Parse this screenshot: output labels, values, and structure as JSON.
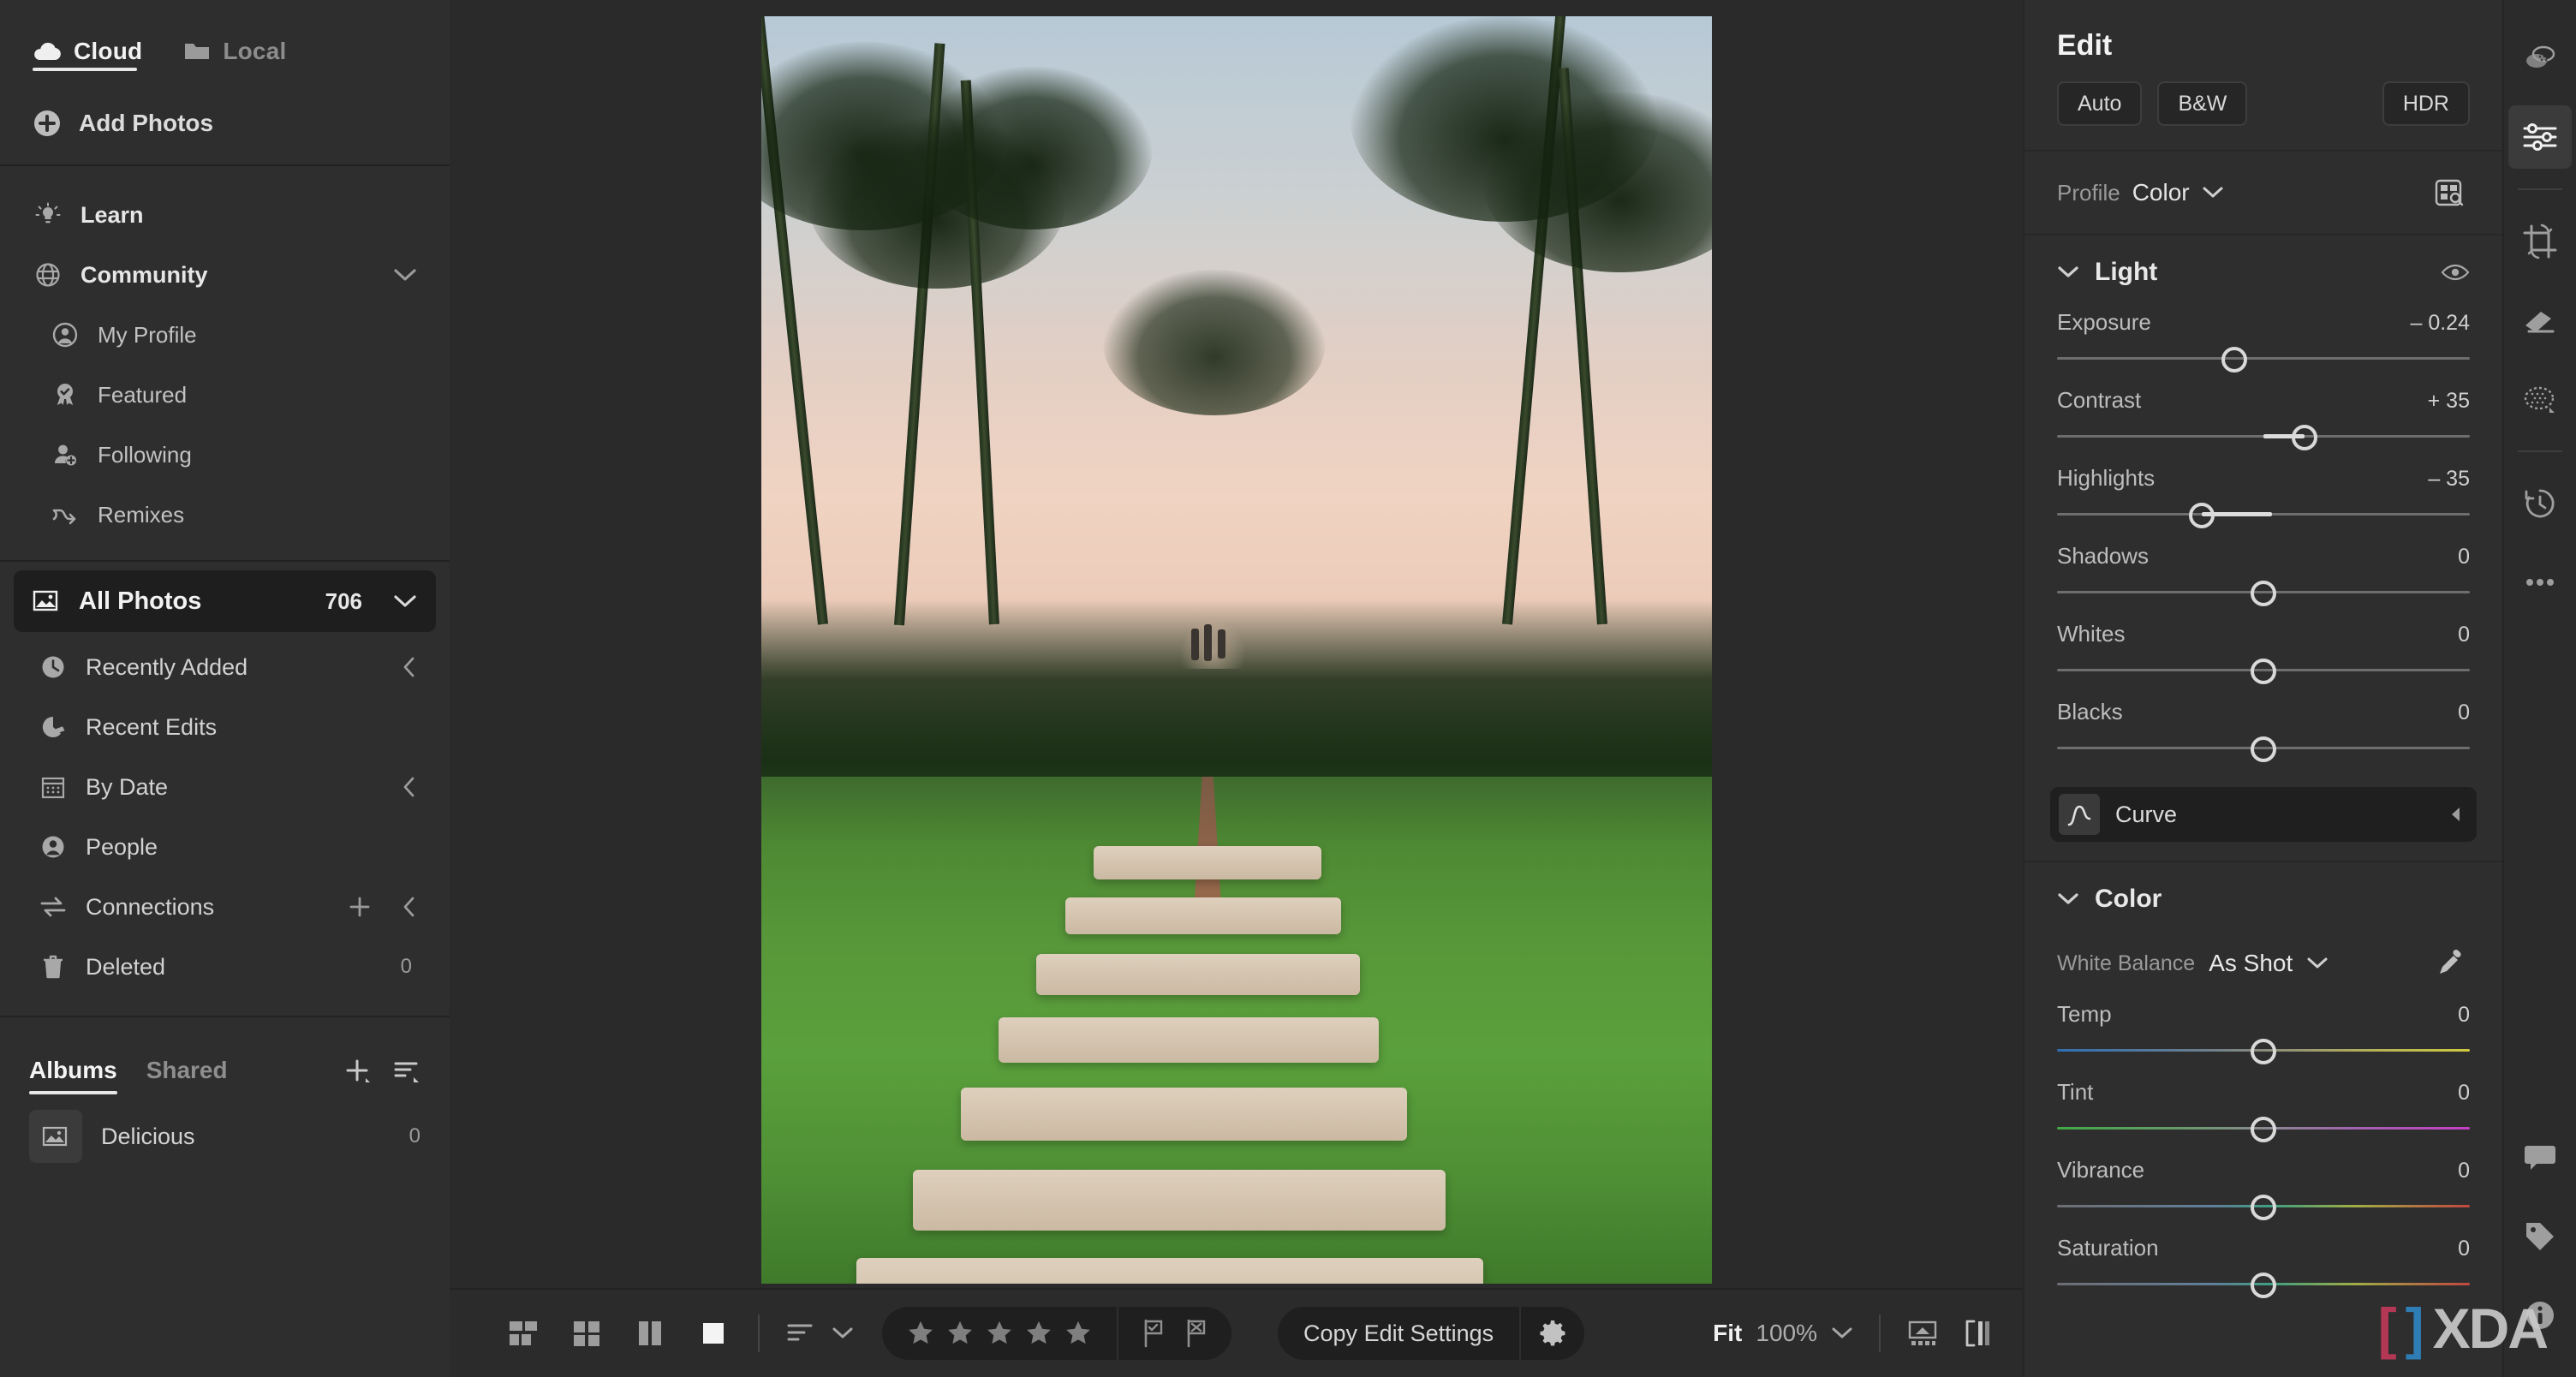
{
  "sidebar": {
    "source_tabs": [
      {
        "label": "Cloud",
        "icon": "cloud-icon",
        "active": true
      },
      {
        "label": "Local",
        "icon": "folder-icon",
        "active": false
      }
    ],
    "add_photos": {
      "label": "Add Photos",
      "icon": "plus-circle-icon"
    },
    "learn": {
      "label": "Learn",
      "icon": "lightbulb-icon"
    },
    "community": {
      "label": "Community",
      "icon": "globe-icon",
      "chevron": "chevron-down-icon"
    },
    "community_items": [
      {
        "label": "My Profile",
        "icon": "user-circle-icon"
      },
      {
        "label": "Featured",
        "icon": "ribbon-check-icon"
      },
      {
        "label": "Following",
        "icon": "user-plus-icon"
      },
      {
        "label": "Remixes",
        "icon": "remix-arrow-icon"
      }
    ],
    "all_photos": {
      "label": "All Photos",
      "count": "706",
      "icon": "photo-icon",
      "chevron": "chevron-down-icon"
    },
    "library_items": [
      {
        "label": "Recently Added",
        "icon": "clock-icon",
        "count": "",
        "chevron": "chevron-left-icon"
      },
      {
        "label": "Recent Edits",
        "icon": "recent-edits-icon",
        "count": "",
        "chevron": ""
      },
      {
        "label": "By Date",
        "icon": "calendar-icon",
        "count": "",
        "chevron": "chevron-left-icon"
      },
      {
        "label": "People",
        "icon": "person-icon",
        "count": "",
        "chevron": ""
      },
      {
        "label": "Connections",
        "icon": "connections-icon",
        "count": "",
        "chevron": "chevron-left-icon",
        "plus": true
      },
      {
        "label": "Deleted",
        "icon": "trash-icon",
        "count": "0",
        "chevron": ""
      }
    ],
    "albums": {
      "tabs": [
        {
          "label": "Albums",
          "active": true
        },
        {
          "label": "Shared",
          "active": false
        }
      ],
      "actions": [
        {
          "name": "add-album-icon",
          "label": "+"
        },
        {
          "name": "sort-albums-icon",
          "label": "sort"
        }
      ],
      "items": [
        {
          "label": "Delicious",
          "count": "0",
          "icon": "album-thumb-icon"
        }
      ]
    }
  },
  "bottombar": {
    "view_modes": [
      {
        "name": "grid-compact-view",
        "icon": "grid-compact-icon"
      },
      {
        "name": "grid-view",
        "icon": "grid-icon"
      },
      {
        "name": "compare-view",
        "icon": "compare-icon"
      },
      {
        "name": "detail-view",
        "icon": "detail-icon"
      }
    ],
    "sort": {
      "icon": "sort-icon",
      "chevron": "chevron-down-icon"
    },
    "rating": {
      "stars": 5,
      "filled": 0,
      "star_icon": "star-icon"
    },
    "flags": [
      {
        "name": "flag-pick-icon",
        "label": "pick"
      },
      {
        "name": "flag-reject-icon",
        "label": "reject"
      }
    ],
    "copy_edit_settings": {
      "label": "Copy Edit Settings",
      "gear": "gear-icon"
    },
    "zoom": {
      "fit_label": "Fit",
      "percent": "100%",
      "chevron": "chevron-down-icon"
    },
    "right_tools": [
      {
        "name": "filmstrip-toggle-icon"
      },
      {
        "name": "before-after-icon"
      }
    ]
  },
  "edit_panel": {
    "title": "Edit",
    "top_buttons": [
      {
        "label": "Auto",
        "name": "auto-button"
      },
      {
        "label": "B&W",
        "name": "bw-button"
      },
      {
        "label": "HDR",
        "name": "hdr-button"
      }
    ],
    "profile": {
      "label": "Profile",
      "value": "Color",
      "chevron": "chevron-down-icon",
      "browse_icon": "browse-profiles-icon"
    },
    "light": {
      "title": "Light",
      "collapse_icon": "chevron-down-icon",
      "visibility_icon": "eye-icon",
      "sliders": [
        {
          "name": "Exposure",
          "value": "– 0.24",
          "pos": 43,
          "fill_from": 43,
          "fill_to": 43
        },
        {
          "name": "Contrast",
          "value": "+ 35",
          "pos": 60,
          "fill_from": 50,
          "fill_to": 60
        },
        {
          "name": "Highlights",
          "value": "– 35",
          "pos": 35,
          "fill_from": 35,
          "fill_to": 52
        },
        {
          "name": "Shadows",
          "value": "0",
          "pos": 50,
          "fill_from": 50,
          "fill_to": 50
        },
        {
          "name": "Whites",
          "value": "0",
          "pos": 50,
          "fill_from": 50,
          "fill_to": 50
        },
        {
          "name": "Blacks",
          "value": "0",
          "pos": 50,
          "fill_from": 50,
          "fill_to": 50
        }
      ]
    },
    "curve": {
      "label": "Curve",
      "icon": "curve-icon",
      "arrow": "triangle-left-icon"
    },
    "color": {
      "title": "Color",
      "collapse_icon": "chevron-down-icon",
      "white_balance": {
        "label": "White Balance",
        "value": "As Shot",
        "chevron": "chevron-down-icon",
        "eyedropper": "eyedropper-icon"
      },
      "sliders": [
        {
          "name": "Temp",
          "value": "0",
          "pos": 50,
          "gradient": "grad-temp"
        },
        {
          "name": "Tint",
          "value": "0",
          "pos": 50,
          "gradient": "grad-tint"
        },
        {
          "name": "Vibrance",
          "value": "0",
          "pos": 50,
          "gradient": "grad-vib"
        },
        {
          "name": "Saturation",
          "value": "0",
          "pos": 50,
          "gradient": "grad-sat"
        }
      ]
    }
  },
  "rail": {
    "top": [
      {
        "name": "presets-icon",
        "active": false
      },
      {
        "name": "edit-sliders-icon",
        "active": true
      }
    ],
    "tools": [
      {
        "name": "crop-rotate-icon",
        "active": false
      },
      {
        "name": "healing-brush-icon",
        "active": false
      },
      {
        "name": "masking-icon",
        "active": false
      }
    ],
    "history": [
      {
        "name": "versions-history-icon",
        "active": false
      },
      {
        "name": "more-options-icon",
        "active": false
      }
    ],
    "bottom": [
      {
        "name": "comments-icon",
        "active": false
      },
      {
        "name": "keywords-tag-icon",
        "active": false
      },
      {
        "name": "info-icon",
        "active": false
      }
    ]
  },
  "watermark": {
    "bracket_left": "[",
    "bracket_right": "]",
    "word": "XDA"
  }
}
